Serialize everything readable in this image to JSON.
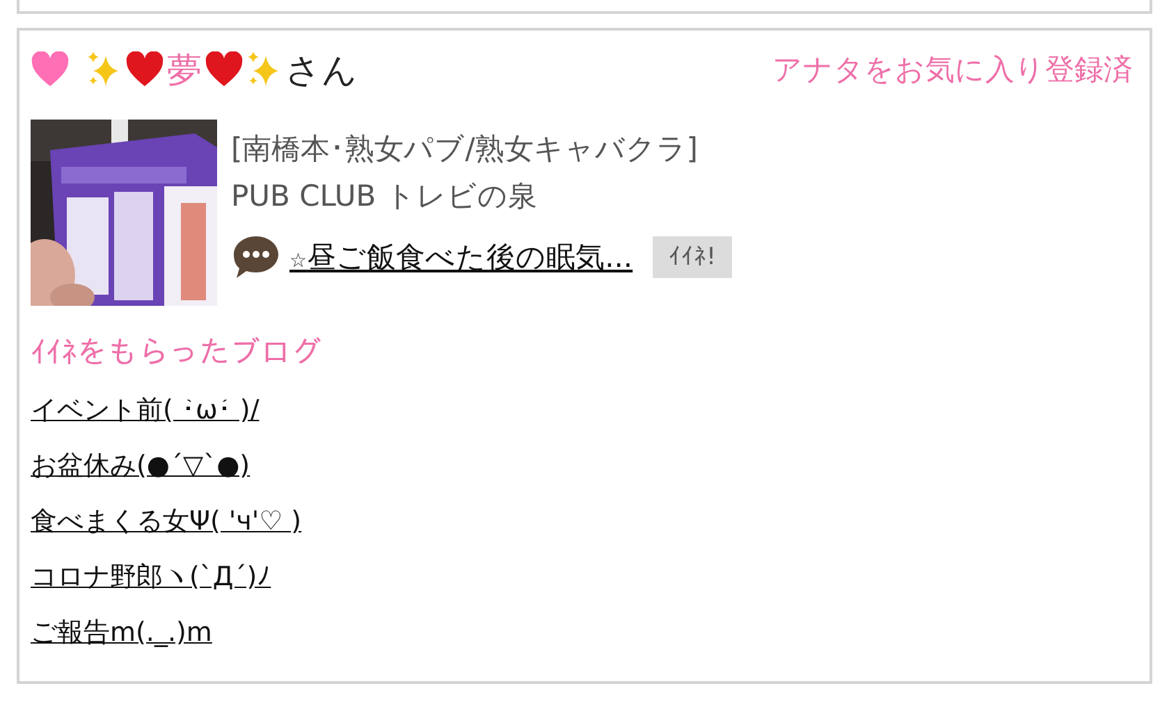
{
  "user": {
    "name_parts": [
      {
        "kind": "pink-heart"
      },
      {
        "kind": "sparkle"
      },
      {
        "kind": "red-heart"
      },
      {
        "kind": "text",
        "text": "夢",
        "color": "#ee6fa8"
      },
      {
        "kind": "red-heart"
      },
      {
        "kind": "sparkle"
      },
      {
        "kind": "text",
        "text": "さん",
        "color": "#222222"
      }
    ],
    "status": "アナタをお気に入り登録済"
  },
  "post": {
    "category": "[南橋本･熟女パブ/熟女キャバクラ]",
    "shop": "PUB CLUB トレビの泉",
    "star": "☆",
    "title": "昼ご飯食べた後の眠気...",
    "like_button": "ｲｲﾈ!"
  },
  "liked_blogs": {
    "heading": "ｲｲﾈをもらったブログ",
    "items": [
      "イベント前( ･̀ω･́ )/",
      "お盆休み(●´▽`●)",
      "食べまくる女Ψ( 'ч'♡ )",
      "コロナ野郎ヽ(`Д´)ﾉ",
      "ご報告m(._.)m"
    ]
  }
}
